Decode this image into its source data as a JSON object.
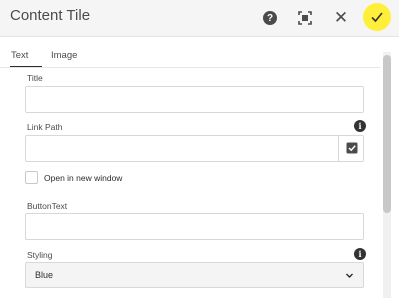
{
  "dialog": {
    "title": "Content Tile"
  },
  "toolbar": {
    "help_icon": "question-circle-icon",
    "fullscreen_icon": "fullscreen-icon",
    "close_icon": "close-icon",
    "confirm_icon": "checkmark-icon",
    "confirm_color": "#ffef3a"
  },
  "tabs": [
    {
      "label": "Text",
      "active": true
    },
    {
      "label": "Image",
      "active": false
    }
  ],
  "form": {
    "title": {
      "label": "Title",
      "value": ""
    },
    "link_path": {
      "label": "Link Path",
      "value": "",
      "info_icon": "info-icon",
      "picker_icon": "checkbox-picker-icon"
    },
    "open_new_window": {
      "label": "Open in new window",
      "checked": false
    },
    "button_text": {
      "label": "ButtonText",
      "value": ""
    },
    "styling": {
      "label": "Styling",
      "selected": "Blue",
      "info_icon": "info-icon"
    }
  }
}
